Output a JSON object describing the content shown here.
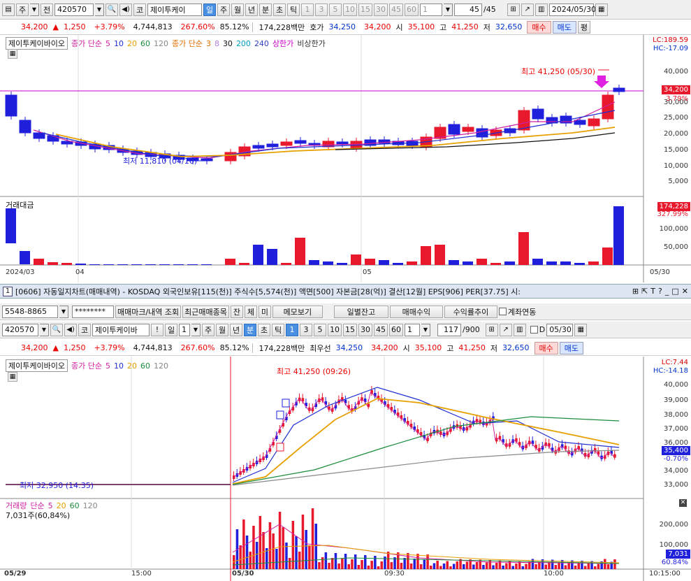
{
  "daily": {
    "toolbar": {
      "chart_icon": "chart-icon",
      "mode1": "주",
      "mode2": "전",
      "code": "420570",
      "search_icon": "search-icon",
      "speaker_icon": "speaker-icon",
      "ko": "코",
      "name": "제이투케이",
      "period_tabs": [
        "일",
        "주",
        "월",
        "년",
        "분",
        "초",
        "틱"
      ],
      "active_period": "일",
      "nums": [
        "1",
        "3",
        "5",
        "10",
        "15",
        "30",
        "45",
        "60"
      ],
      "count": "1",
      "range": "45",
      "range_total": "/45",
      "date": "2024/05/30",
      "calendar_icon": "calendar-icon",
      "save_icon": "save-icon",
      "settings_icon": "gear-icon"
    },
    "price": {
      "close": "34,200",
      "change": "1,250",
      "pct": "+3.79%",
      "volume": "4,744,813",
      "vol_ratio": "267.60%",
      "turnover": "85.12%",
      "amount": "174,228백만",
      "quote_label": "호가",
      "ask": "34,250",
      "bid": "34,200",
      "open_label": "시",
      "open": "35,100",
      "high_label": "고",
      "high": "41,250",
      "low_label": "저",
      "low": "32,650",
      "buy": "매수",
      "sell": "매도",
      "avg": "평"
    },
    "legend": {
      "name": "제이투케이바이오",
      "ma1_label": "종가 단순",
      "ma1": [
        "5",
        "10",
        "20",
        "60",
        "120"
      ],
      "ma2_label": "종가 단순",
      "ma2": [
        "3",
        "8",
        "30",
        "200",
        "240"
      ],
      "upper": "상한가",
      "lower": "비상한가"
    },
    "lc": "LC:189.59",
    "hc": "HC:-17.09",
    "price_badge": "34,200",
    "pct_badge": "3.79%",
    "y_ticks": [
      "40,000",
      "35,000",
      "30,000",
      "25,000",
      "20,000",
      "15,000",
      "10,000",
      "5,000"
    ],
    "high_label": "최고 41,250 (05/30)",
    "low_label": "최저 11,810 (04/16)",
    "vol_title": "거래대금",
    "vol_badge": "174,228",
    "vol_pct": "327.99%",
    "vol_ticks": [
      "100,000",
      "50,000"
    ],
    "x_labels": [
      "2024/03",
      "04",
      "05",
      "05/30"
    ]
  },
  "window": {
    "num": "1",
    "title": "[0606] 자동일지차트(매매내역) - KOSDAQ 외국인보유[115(천)] 주식수[5,574(천)] 액면[500] 자본금[28(억)] 결산[12월] EPS[906] PER[37.75] 시:",
    "icons": [
      "lock-icon",
      "link-icon",
      "T",
      "?",
      "_",
      "□",
      "×"
    ]
  },
  "acct": {
    "account": "5548-8865",
    "password": "********",
    "b1": "매매마크/내역 조회",
    "b2": "최근매매종목",
    "b3": "잔",
    "b4": "체",
    "b5": "미",
    "b6": "메모보기",
    "b7": "일별잔고",
    "b8": "매매수익",
    "b9": "수익률추이",
    "chk": "계좌연동"
  },
  "minute": {
    "toolbar": {
      "code": "420570",
      "ko": "코",
      "name": "제이투케이바",
      "warn": "!",
      "period": "일",
      "cnt": "1",
      "tabs": [
        "주",
        "월",
        "년",
        "분",
        "초",
        "틱"
      ],
      "active": "분",
      "nums": [
        "1",
        "3",
        "5",
        "10",
        "15",
        "30",
        "45",
        "60"
      ],
      "active_num": "1",
      "count": "1",
      "range": "117",
      "range_total": "/900",
      "d_label": "D",
      "date": "05/30"
    },
    "price": {
      "close": "34,200",
      "change": "1,250",
      "pct": "+3.79%",
      "volume": "4,744,813",
      "vol_ratio": "267.60%",
      "turnover": "85.12%",
      "amount": "174,228백만",
      "quote_label": "최우선",
      "ask": "34,250",
      "bid": "34,200",
      "open_label": "시",
      "open": "35,100",
      "high_label": "고",
      "high": "41,250",
      "low_label": "저",
      "low": "32,650",
      "buy": "매수",
      "sell": "매도"
    },
    "legend": {
      "name": "제이투케이바이오",
      "ma_label": "종가 단순",
      "ma": [
        "5",
        "10",
        "20",
        "60",
        "120"
      ]
    },
    "lc": "LC:7.44",
    "hc": "HC:-14.18",
    "price_badge": "35,400",
    "pct_badge": "-0.70%",
    "y_ticks": [
      "40,000",
      "39,000",
      "38,000",
      "37,000",
      "36,000",
      "35,000",
      "34,000",
      "33,000"
    ],
    "high_label": "최고 41,250 (09:26)",
    "low_label": "최저 32,950 (14:35)",
    "vol_title": "거래량",
    "vol_ma_label": "단순",
    "vol_ma": [
      "5",
      "20",
      "60",
      "120"
    ],
    "vol_info": "7,031주(60,84%)",
    "vol_ticks": [
      "200,000",
      "100,000"
    ],
    "vol_badge": "7,031",
    "vol_pct": "60.84%",
    "x_labels": [
      "05/29",
      "15:00",
      "05/30",
      "09:30",
      "10:00",
      "10:15:00"
    ]
  },
  "colors": {
    "up": "#e8192c",
    "down": "#1f1fdc",
    "limit": "#cc00cc",
    "ma5": "#d11fa0",
    "ma10": "#1f2fd1",
    "ma20": "#e6a000",
    "ma60": "#1c8c3c",
    "ma120": "#888888"
  }
}
